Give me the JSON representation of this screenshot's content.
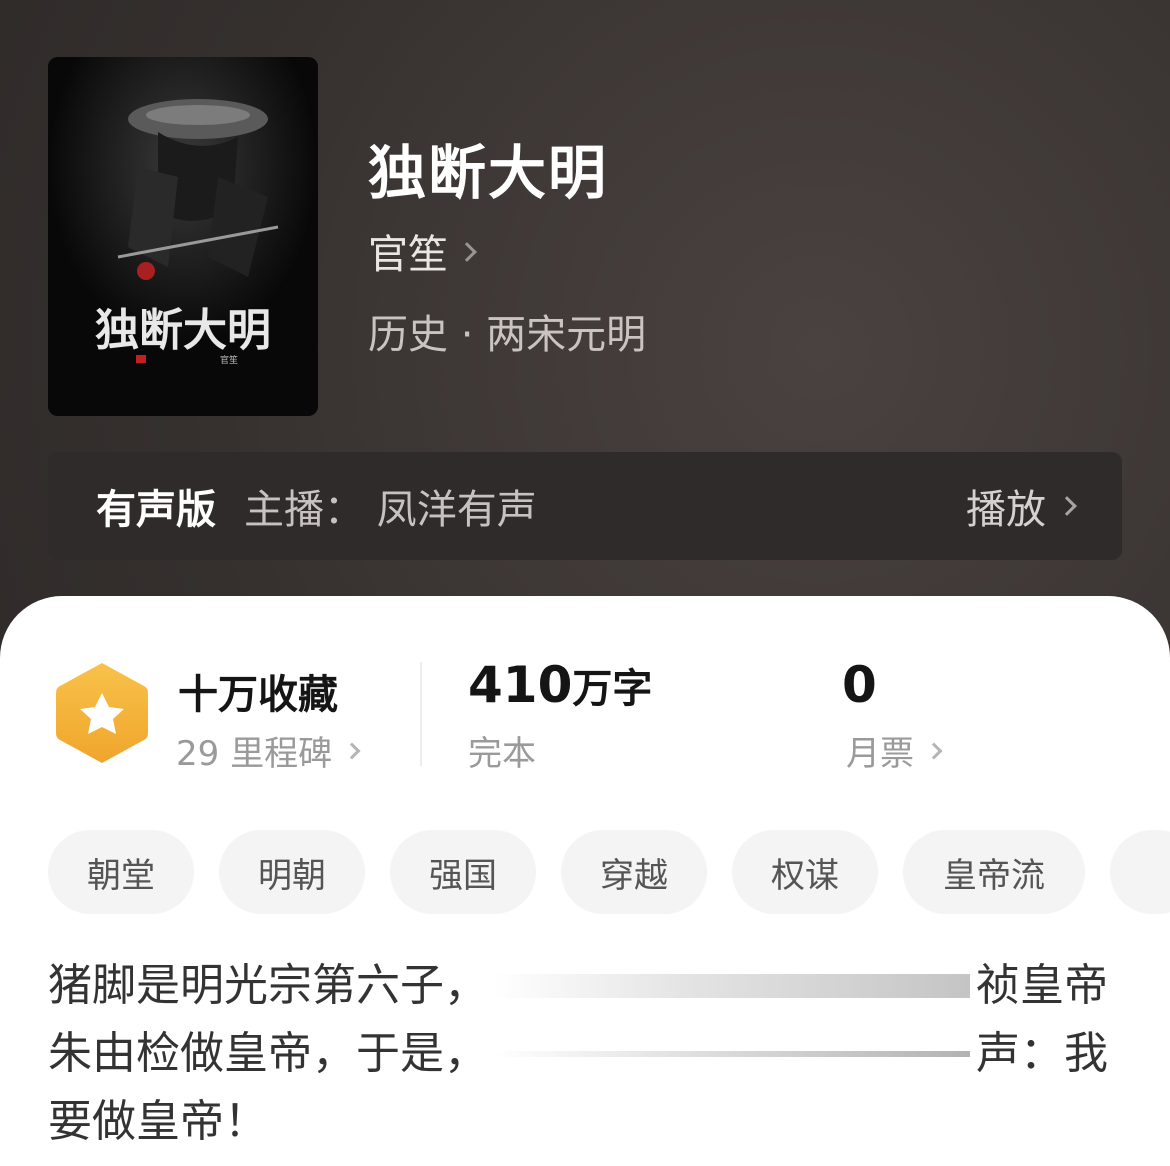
{
  "book": {
    "title": "独断大明",
    "author": "官笙",
    "category": "历史 · 两宋元明",
    "cover_title_text": "独断大明",
    "cover_author_text": "官笙"
  },
  "audio": {
    "label": "有声版",
    "narrator": "主播：  凤洋有声",
    "play_label": "播放"
  },
  "stats": {
    "collection_main": "十万收藏",
    "collection_sub": "29 里程碑",
    "words_main": "410",
    "words_unit": "万字",
    "words_sub": "完本",
    "tickets_main": "0",
    "tickets_sub": "月票"
  },
  "tags": [
    "朝堂",
    "明朝",
    "强国",
    "穿越",
    "权谋",
    "皇帝流"
  ],
  "synopsis": {
    "line1_start": "猪脚是明光宗第六子，",
    "line1_end": "祯皇帝",
    "line2_start": "朱由检做皇帝，于是，",
    "line2_end": "声：我",
    "line3": "要做皇帝！"
  },
  "colors": {
    "header_bg": "#35302e",
    "badge_orange": "#f5b335",
    "tag_bg": "#f4f4f4"
  },
  "icons": [
    "star-badge-icon",
    "chevron-right-icon"
  ]
}
